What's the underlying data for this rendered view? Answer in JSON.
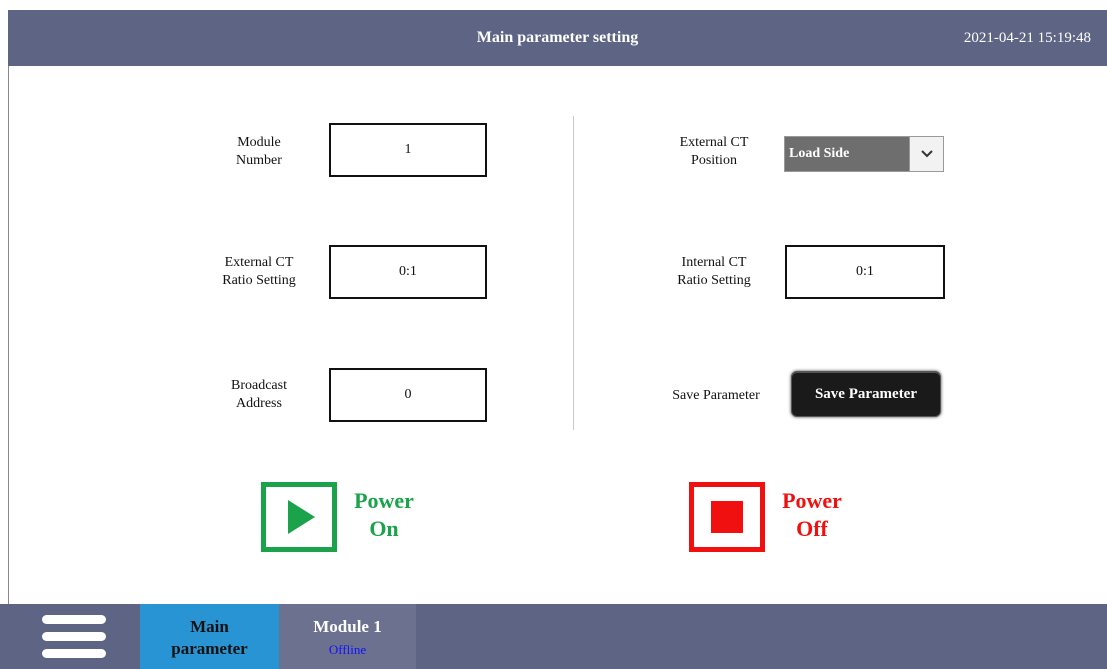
{
  "header": {
    "title": "Main parameter setting",
    "datetime": "2021-04-21 15:19:48"
  },
  "left": {
    "module_number": {
      "label": [
        "Module",
        "Number"
      ],
      "value": "1"
    },
    "ext_ct_ratio": {
      "label": [
        "External CT",
        "Ratio Setting"
      ],
      "value": "0:1"
    },
    "broadcast": {
      "label": [
        "Broadcast",
        "Address"
      ],
      "value": "0"
    }
  },
  "right": {
    "ext_ct_position": {
      "label": [
        "External CT",
        "Position"
      ],
      "value": "Load Side",
      "icon": "chevron-down-icon"
    },
    "int_ct_ratio": {
      "label": [
        "Internal CT",
        "Ratio Setting"
      ],
      "value": "0:1"
    },
    "save": {
      "label": "Save Parameter",
      "button": "Save Parameter"
    }
  },
  "power": {
    "on": {
      "line1": "Power",
      "line2": "On",
      "color": "#1aa34a",
      "icon": "play-icon"
    },
    "off": {
      "line1": "Power",
      "line2": "Off",
      "color": "#f01010",
      "icon": "stop-icon"
    }
  },
  "footer": {
    "menu_icon": "hamburger-menu-icon",
    "tabs": [
      {
        "line1": "Main",
        "line2": "parameter",
        "active": true,
        "color": "#2894d4"
      },
      {
        "name": "Module 1",
        "status": "Offline",
        "status_color": "#1010ff"
      }
    ]
  },
  "colors": {
    "bar": "#5d6484"
  }
}
